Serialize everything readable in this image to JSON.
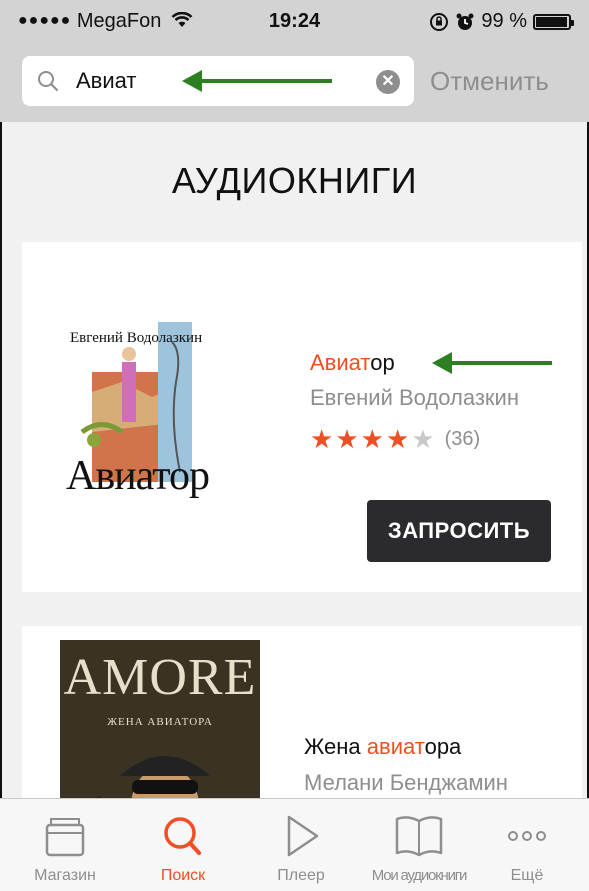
{
  "status": {
    "dots": "●●●●●",
    "carrier": "MegaFon",
    "time": "19:24",
    "battery": "99 %"
  },
  "search": {
    "value": "Авиат",
    "cancel": "Отменить"
  },
  "section_title": "АУДИОКНИГИ",
  "books": [
    {
      "title_highlight": "Авиат",
      "title_rest": "ор",
      "author": "Евгений Водолазкин",
      "rating_stars": 4,
      "rating_count": "(36)",
      "button": "ЗАПРОСИТЬ",
      "cover_author": "Евгений Водолазкин",
      "cover_title": "Авиатор"
    },
    {
      "title_prefix": "Жена ",
      "title_highlight": "авиат",
      "title_rest": "ора",
      "author": "Мелани Бенджамин",
      "cover_title": "AMORE",
      "cover_subtitle": "ЖЕНА АВИАТОРА"
    }
  ],
  "tabs": [
    {
      "label": "Магазин",
      "icon": "shop-icon",
      "active": false
    },
    {
      "label": "Поиск",
      "icon": "search-icon",
      "active": true
    },
    {
      "label": "Плеер",
      "icon": "play-icon",
      "active": false
    },
    {
      "label": "Мои аудиокниги",
      "icon": "book-icon",
      "active": false
    },
    {
      "label": "Ещё",
      "icon": "more-icon",
      "active": false
    }
  ],
  "colors": {
    "accent": "#f04e23",
    "arrow": "#2d7f22",
    "button": "#2b2b2e"
  }
}
